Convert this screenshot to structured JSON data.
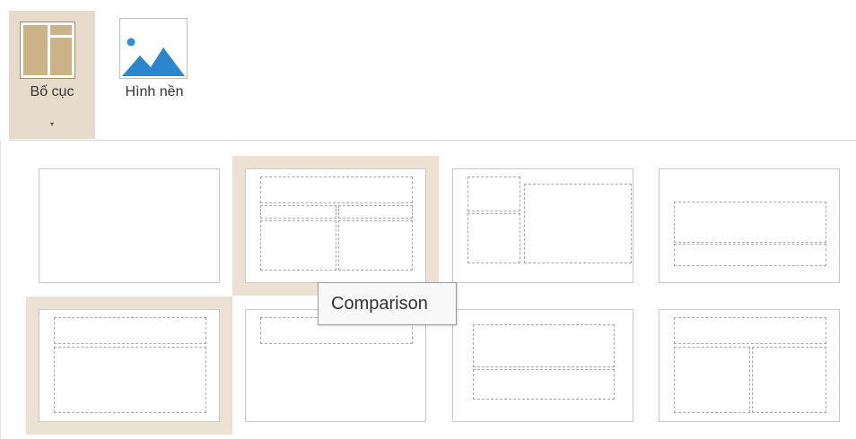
{
  "ribbon": {
    "layout_button": {
      "label": "Bố cục",
      "caret": "▾",
      "icon": "layout-icon"
    },
    "background_button": {
      "label": "Hình nền",
      "icon": "picture-icon"
    }
  },
  "gallery": {
    "layouts": [
      {
        "id": "blank",
        "selected": false,
        "hovered": false
      },
      {
        "id": "comparison",
        "selected": false,
        "hovered": true
      },
      {
        "id": "content-with-caption",
        "selected": false,
        "hovered": false
      },
      {
        "id": "title-subtitle",
        "selected": false,
        "hovered": false
      },
      {
        "id": "title-and-content",
        "selected": true,
        "hovered": false
      },
      {
        "id": "title-only",
        "selected": false,
        "hovered": false
      },
      {
        "id": "section-header",
        "selected": false,
        "hovered": false
      },
      {
        "id": "two-content",
        "selected": false,
        "hovered": false
      }
    ]
  },
  "tooltip": {
    "text": "Comparison"
  },
  "colors": {
    "selected_bg": "#e7dccb",
    "hover_frame": "#ece2d4",
    "placeholder_border": "#a9a9a9"
  }
}
